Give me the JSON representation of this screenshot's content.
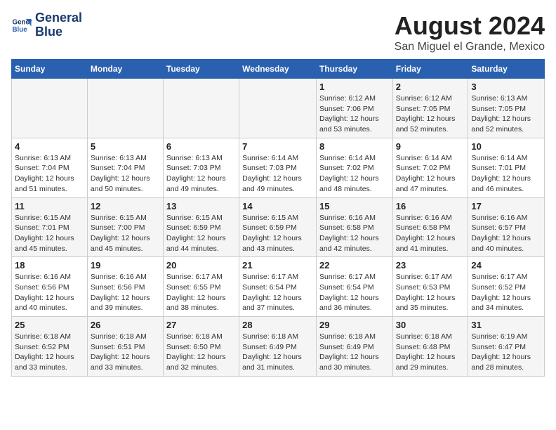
{
  "header": {
    "logo_line1": "General",
    "logo_line2": "Blue",
    "month_year": "August 2024",
    "location": "San Miguel el Grande, Mexico"
  },
  "days_of_week": [
    "Sunday",
    "Monday",
    "Tuesday",
    "Wednesday",
    "Thursday",
    "Friday",
    "Saturday"
  ],
  "weeks": [
    [
      {
        "day": "",
        "info": ""
      },
      {
        "day": "",
        "info": ""
      },
      {
        "day": "",
        "info": ""
      },
      {
        "day": "",
        "info": ""
      },
      {
        "day": "1",
        "info": "Sunrise: 6:12 AM\nSunset: 7:06 PM\nDaylight: 12 hours\nand 53 minutes."
      },
      {
        "day": "2",
        "info": "Sunrise: 6:12 AM\nSunset: 7:05 PM\nDaylight: 12 hours\nand 52 minutes."
      },
      {
        "day": "3",
        "info": "Sunrise: 6:13 AM\nSunset: 7:05 PM\nDaylight: 12 hours\nand 52 minutes."
      }
    ],
    [
      {
        "day": "4",
        "info": "Sunrise: 6:13 AM\nSunset: 7:04 PM\nDaylight: 12 hours\nand 51 minutes."
      },
      {
        "day": "5",
        "info": "Sunrise: 6:13 AM\nSunset: 7:04 PM\nDaylight: 12 hours\nand 50 minutes."
      },
      {
        "day": "6",
        "info": "Sunrise: 6:13 AM\nSunset: 7:03 PM\nDaylight: 12 hours\nand 49 minutes."
      },
      {
        "day": "7",
        "info": "Sunrise: 6:14 AM\nSunset: 7:03 PM\nDaylight: 12 hours\nand 49 minutes."
      },
      {
        "day": "8",
        "info": "Sunrise: 6:14 AM\nSunset: 7:02 PM\nDaylight: 12 hours\nand 48 minutes."
      },
      {
        "day": "9",
        "info": "Sunrise: 6:14 AM\nSunset: 7:02 PM\nDaylight: 12 hours\nand 47 minutes."
      },
      {
        "day": "10",
        "info": "Sunrise: 6:14 AM\nSunset: 7:01 PM\nDaylight: 12 hours\nand 46 minutes."
      }
    ],
    [
      {
        "day": "11",
        "info": "Sunrise: 6:15 AM\nSunset: 7:01 PM\nDaylight: 12 hours\nand 45 minutes."
      },
      {
        "day": "12",
        "info": "Sunrise: 6:15 AM\nSunset: 7:00 PM\nDaylight: 12 hours\nand 45 minutes."
      },
      {
        "day": "13",
        "info": "Sunrise: 6:15 AM\nSunset: 6:59 PM\nDaylight: 12 hours\nand 44 minutes."
      },
      {
        "day": "14",
        "info": "Sunrise: 6:15 AM\nSunset: 6:59 PM\nDaylight: 12 hours\nand 43 minutes."
      },
      {
        "day": "15",
        "info": "Sunrise: 6:16 AM\nSunset: 6:58 PM\nDaylight: 12 hours\nand 42 minutes."
      },
      {
        "day": "16",
        "info": "Sunrise: 6:16 AM\nSunset: 6:58 PM\nDaylight: 12 hours\nand 41 minutes."
      },
      {
        "day": "17",
        "info": "Sunrise: 6:16 AM\nSunset: 6:57 PM\nDaylight: 12 hours\nand 40 minutes."
      }
    ],
    [
      {
        "day": "18",
        "info": "Sunrise: 6:16 AM\nSunset: 6:56 PM\nDaylight: 12 hours\nand 40 minutes."
      },
      {
        "day": "19",
        "info": "Sunrise: 6:16 AM\nSunset: 6:56 PM\nDaylight: 12 hours\nand 39 minutes."
      },
      {
        "day": "20",
        "info": "Sunrise: 6:17 AM\nSunset: 6:55 PM\nDaylight: 12 hours\nand 38 minutes."
      },
      {
        "day": "21",
        "info": "Sunrise: 6:17 AM\nSunset: 6:54 PM\nDaylight: 12 hours\nand 37 minutes."
      },
      {
        "day": "22",
        "info": "Sunrise: 6:17 AM\nSunset: 6:54 PM\nDaylight: 12 hours\nand 36 minutes."
      },
      {
        "day": "23",
        "info": "Sunrise: 6:17 AM\nSunset: 6:53 PM\nDaylight: 12 hours\nand 35 minutes."
      },
      {
        "day": "24",
        "info": "Sunrise: 6:17 AM\nSunset: 6:52 PM\nDaylight: 12 hours\nand 34 minutes."
      }
    ],
    [
      {
        "day": "25",
        "info": "Sunrise: 6:18 AM\nSunset: 6:52 PM\nDaylight: 12 hours\nand 33 minutes."
      },
      {
        "day": "26",
        "info": "Sunrise: 6:18 AM\nSunset: 6:51 PM\nDaylight: 12 hours\nand 33 minutes."
      },
      {
        "day": "27",
        "info": "Sunrise: 6:18 AM\nSunset: 6:50 PM\nDaylight: 12 hours\nand 32 minutes."
      },
      {
        "day": "28",
        "info": "Sunrise: 6:18 AM\nSunset: 6:49 PM\nDaylight: 12 hours\nand 31 minutes."
      },
      {
        "day": "29",
        "info": "Sunrise: 6:18 AM\nSunset: 6:49 PM\nDaylight: 12 hours\nand 30 minutes."
      },
      {
        "day": "30",
        "info": "Sunrise: 6:18 AM\nSunset: 6:48 PM\nDaylight: 12 hours\nand 29 minutes."
      },
      {
        "day": "31",
        "info": "Sunrise: 6:19 AM\nSunset: 6:47 PM\nDaylight: 12 hours\nand 28 minutes."
      }
    ]
  ]
}
